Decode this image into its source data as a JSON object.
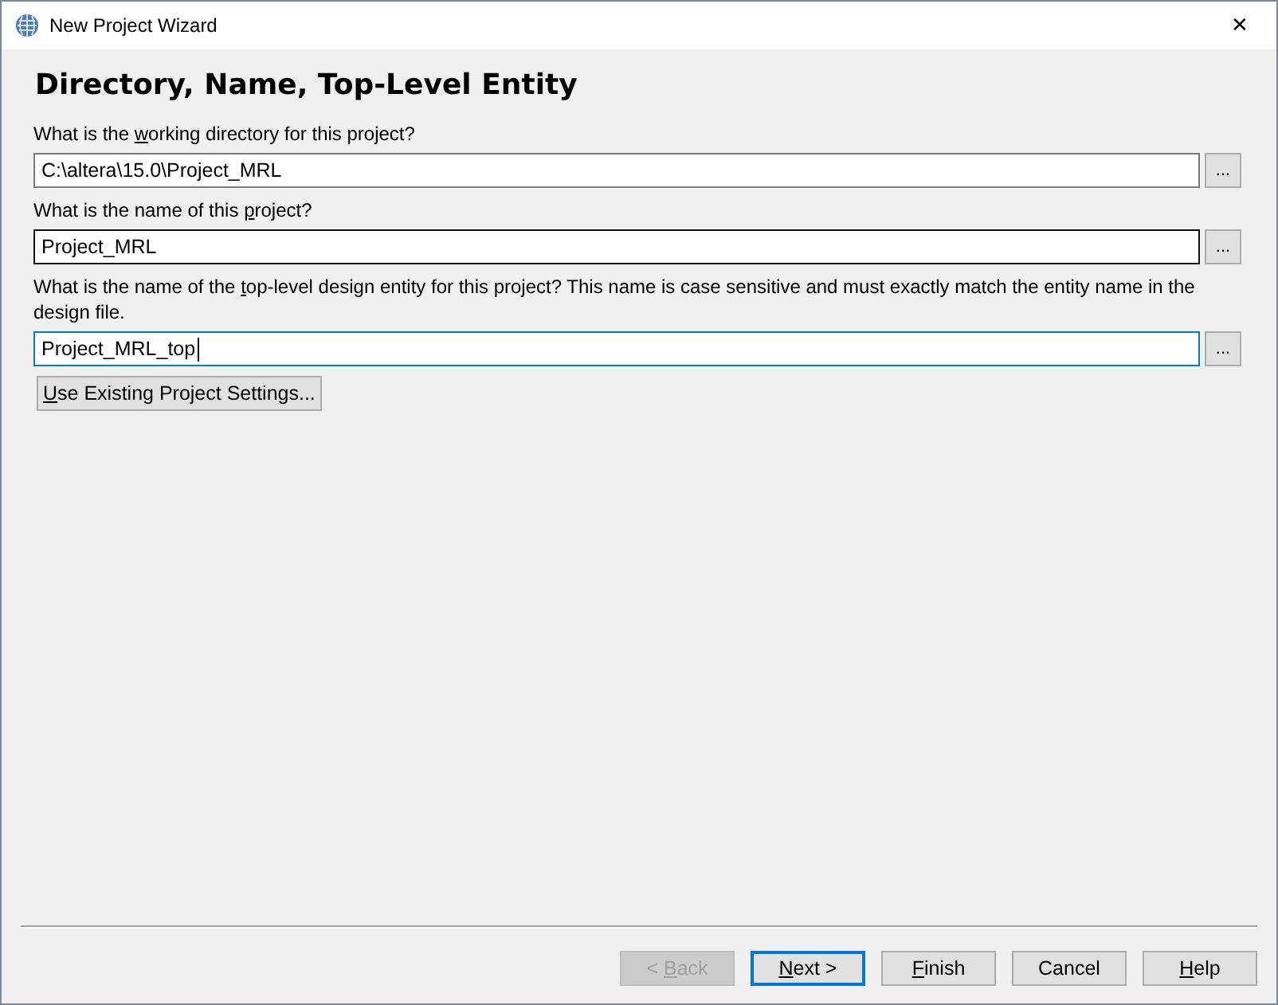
{
  "window": {
    "title": "New Project Wizard",
    "close": "✕"
  },
  "heading": "Directory, Name, Top-Level Entity",
  "fields": [
    {
      "label": {
        "before": "What is the ",
        "key": "w",
        "after": "orking directory for this project?"
      },
      "value": "C:\\altera\\15.0\\Project_MRL",
      "hovered": false,
      "focused": false,
      "browse": "..."
    },
    {
      "label": {
        "before": "What is the name of this ",
        "key": "p",
        "after": "roject?"
      },
      "value": "Project_MRL",
      "hovered": true,
      "focused": false,
      "browse": "..."
    },
    {
      "label": {
        "before": "What is the name of the ",
        "key": "t",
        "after": "op-level design entity for this project? This name is case sensitive and must exactly match the entity name in the design file."
      },
      "value": "Project_MRL_top",
      "hovered": false,
      "focused": true,
      "browse": "..."
    }
  ],
  "settings_button": {
    "key": "U",
    "after": "se Existing Project Settings..."
  },
  "buttons": [
    {
      "before": "< ",
      "key": "B",
      "after": "ack",
      "disabled": true,
      "default": false
    },
    {
      "key": "N",
      "after": "ext >",
      "disabled": false,
      "default": true
    },
    {
      "key": "F",
      "after": "inish",
      "disabled": false,
      "default": false
    },
    {
      "after": "Cancel",
      "disabled": false,
      "default": false
    },
    {
      "key": "H",
      "after": "elp",
      "disabled": false,
      "default": false
    }
  ]
}
